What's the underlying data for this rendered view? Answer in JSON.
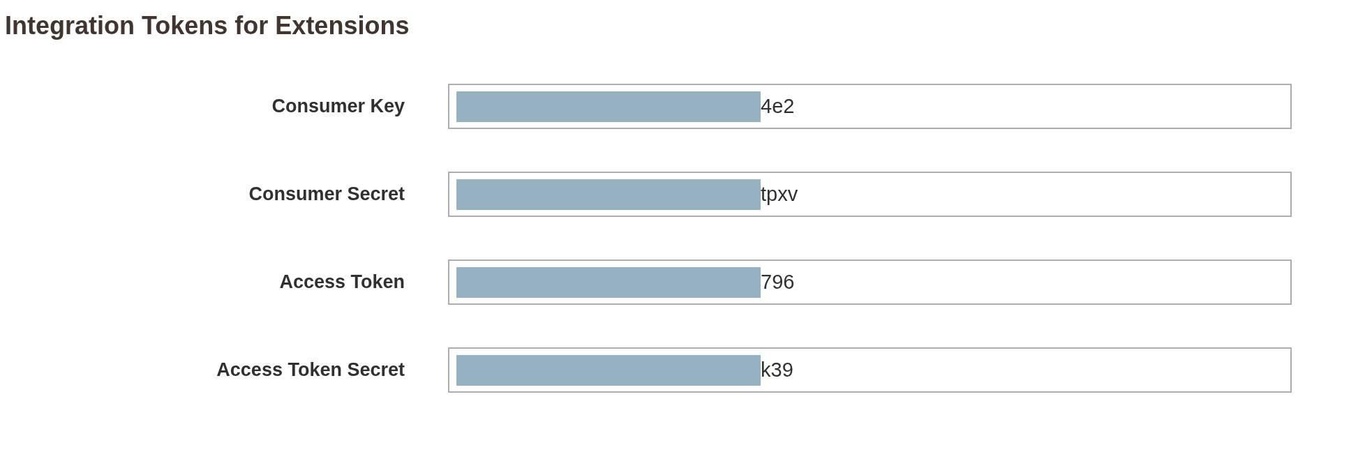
{
  "title": "Integration Tokens for Extensions",
  "fields": [
    {
      "label": "Consumer Key",
      "value": "4e2",
      "redacted": true
    },
    {
      "label": "Consumer Secret",
      "value": "tpxv",
      "redacted": true
    },
    {
      "label": "Access Token",
      "value": "796",
      "redacted": true
    },
    {
      "label": "Access Token Secret",
      "value": "k39",
      "redacted": true
    }
  ]
}
